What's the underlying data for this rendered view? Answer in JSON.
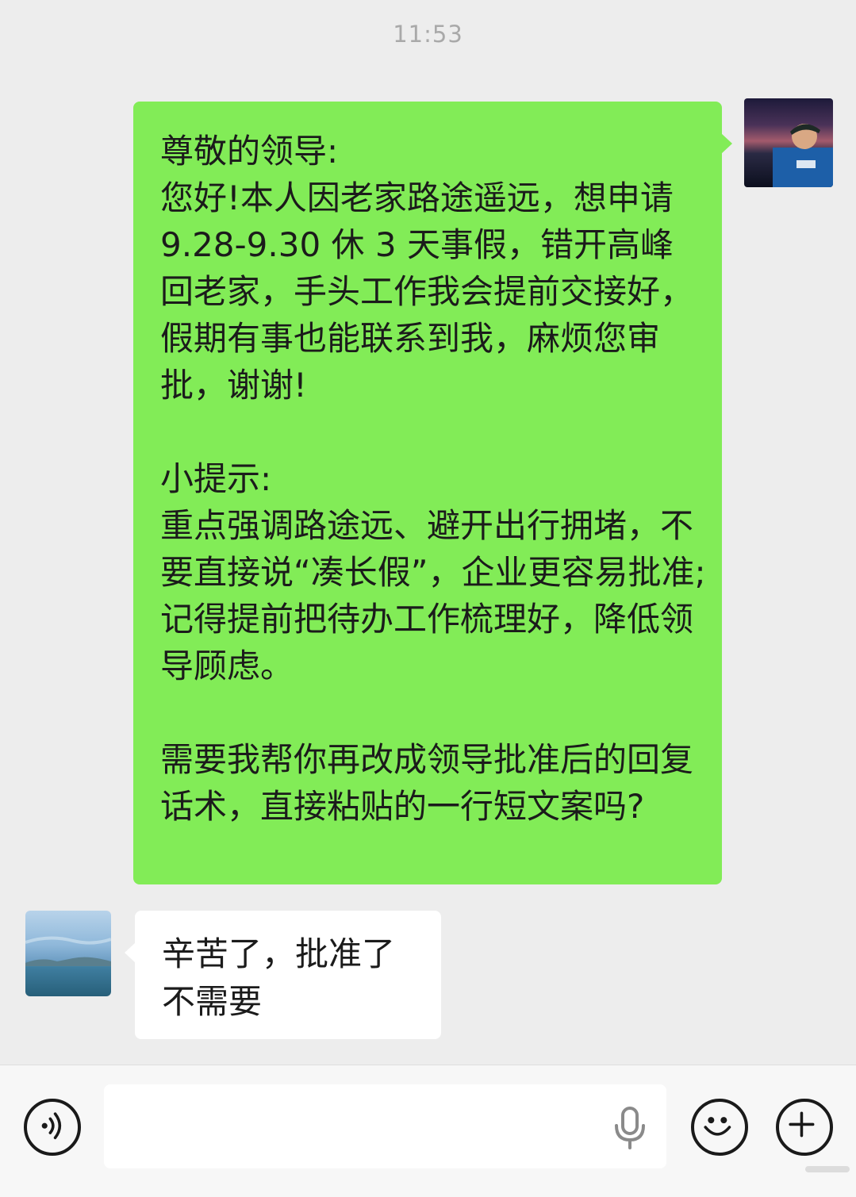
{
  "timestamp": "11:53",
  "messages": [
    {
      "sender": "self",
      "text": "尊敬的领导:\n您好!本人因老家路途遥远，想申请 9.28-9.30 休 3 天事假，错开高峰回老家，手头工作我会提前交接好，假期有事也能联系到我，麻烦您审批，谢谢!\n\n小提示:\n重点强调路途远、避开出行拥堵，不要直接说“凑长假”，企业更容易批准;记得提前把待办工作梳理好，降低领导顾虑。\n\n需要我帮你再改成领导批准后的回复话术，直接粘贴的一行短文案吗?",
      "bubble_color": "#82ec57"
    },
    {
      "sender": "other",
      "text": "辛苦了，批准了\n不需要",
      "bubble_color": "#ffffff"
    }
  ],
  "input_bar": {
    "placeholder": "",
    "value": "",
    "icons": [
      "voice-mode-icon",
      "microphone-icon",
      "emoji-icon",
      "plus-icon"
    ]
  }
}
